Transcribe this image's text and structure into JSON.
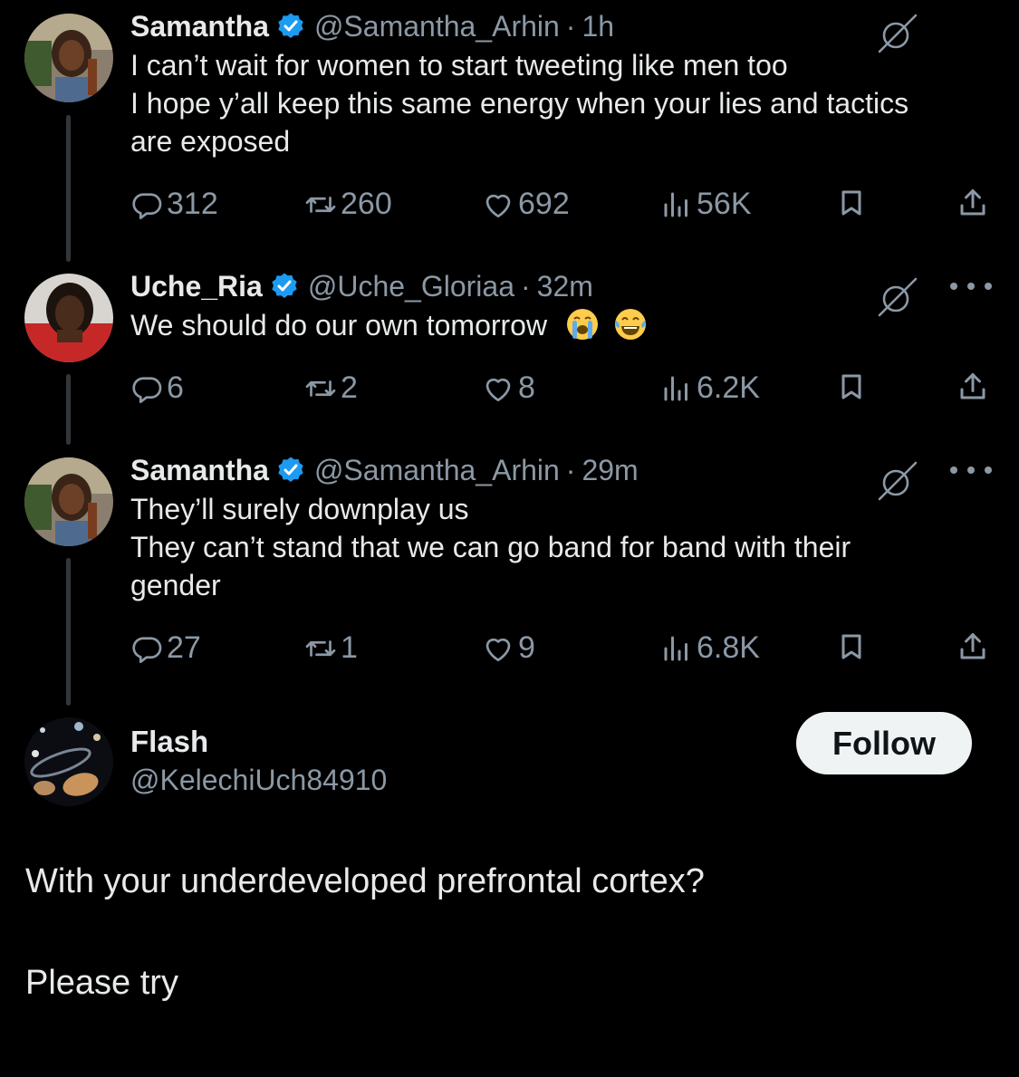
{
  "colors": {
    "background": "#000000",
    "text": "#e7e9ea",
    "secondary_text": "#8b98a5",
    "verified": "#1d9bf0",
    "thread_line": "#333639",
    "follow_button_bg": "#eff3f4"
  },
  "thread": [
    {
      "name": "Samantha",
      "verified": true,
      "handle": "@Samantha_Arhin",
      "separator": "·",
      "time": "1h",
      "text_lines": [
        "I can’t wait for women to start tweeting like men too",
        "I hope y’all keep this same energy when your lies and tactics",
        "are exposed"
      ],
      "replies": "312",
      "reposts": "260",
      "likes": "692",
      "views": "56K",
      "icons": [
        "reply-icon",
        "repost-icon",
        "like-icon",
        "views-icon",
        "bookmark-icon",
        "share-icon",
        "grok-icon"
      ]
    },
    {
      "name": "Uche_Ria",
      "verified": true,
      "handle": "@Uche_Gloriaa",
      "separator": "·",
      "time": "32m",
      "text_lines": [
        "We should do our own tomorrow"
      ],
      "emojis": [
        "loudly-crying-face-emoji",
        "tears-of-joy-emoji"
      ],
      "replies": "6",
      "reposts": "2",
      "likes": "8",
      "views": "6.2K",
      "icons": [
        "reply-icon",
        "repost-icon",
        "like-icon",
        "views-icon",
        "bookmark-icon",
        "share-icon",
        "grok-icon",
        "more-icon"
      ]
    },
    {
      "name": "Samantha",
      "verified": true,
      "handle": "@Samantha_Arhin",
      "separator": "·",
      "time": "29m",
      "text_lines": [
        "They’ll surely downplay us",
        "They can’t stand that we can go band for band with their",
        "gender"
      ],
      "replies": "27",
      "reposts": "1",
      "likes": "9",
      "views": "6.8K",
      "icons": [
        "reply-icon",
        "repost-icon",
        "like-icon",
        "views-icon",
        "bookmark-icon",
        "share-icon",
        "grok-icon",
        "more-icon"
      ]
    }
  ],
  "main_tweet": {
    "name": "Flash",
    "handle": "@KelechiUch84910",
    "follow_label": "Follow",
    "paragraphs": [
      "With your underdeveloped prefrontal cortex?",
      "Please try"
    ]
  }
}
